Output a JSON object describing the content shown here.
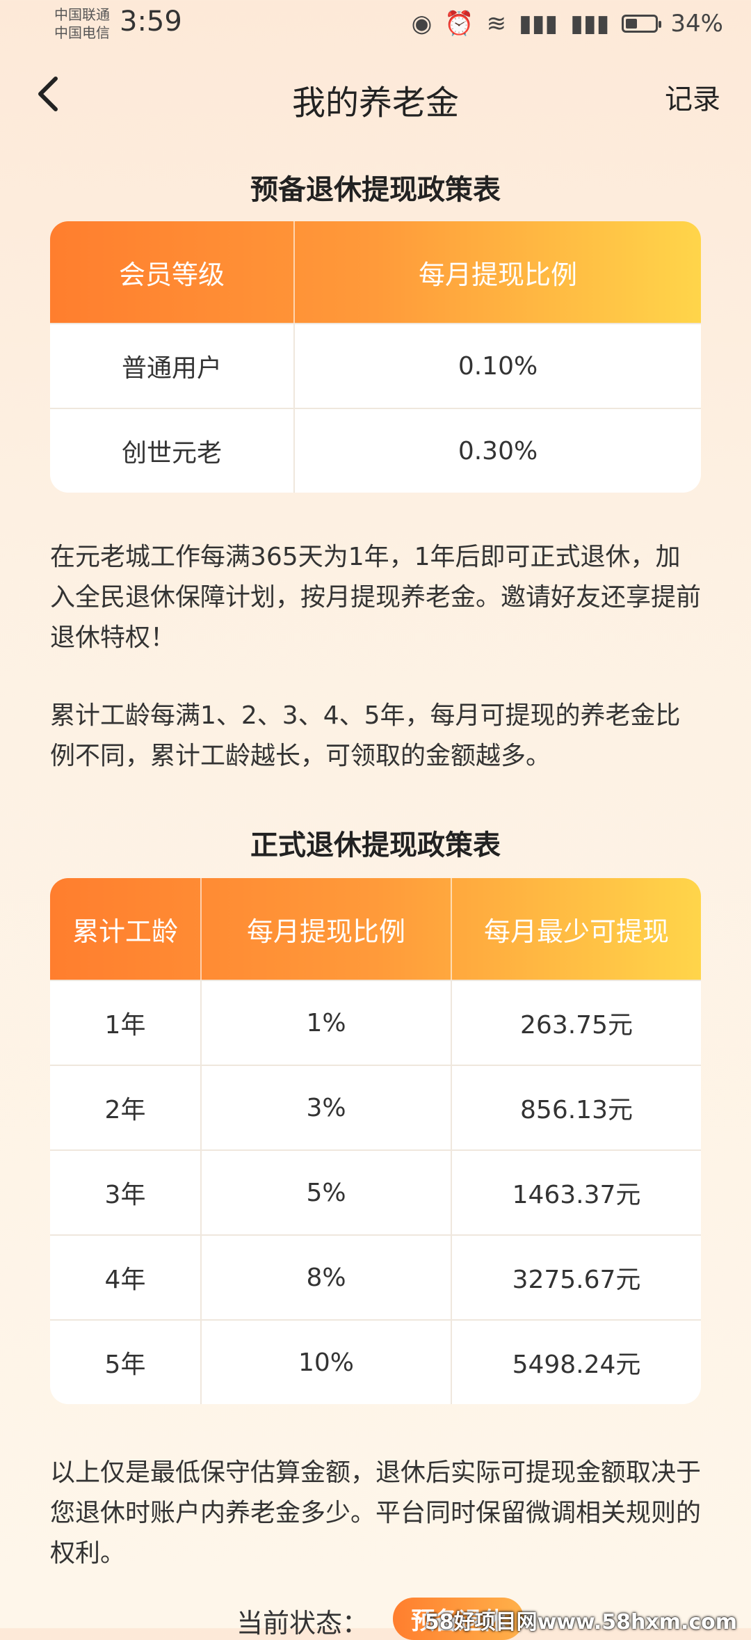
{
  "status_bar": {
    "carrier1": "中国联通",
    "carrier2": "中国电信",
    "time": "3:59",
    "battery": "34%"
  },
  "nav": {
    "back_icon": "chevron-left-icon",
    "title": "我的养老金",
    "record": "记录"
  },
  "prep_table": {
    "title": "预备退休提现政策表",
    "headers": [
      "会员等级",
      "每月提现比例"
    ],
    "rows": [
      [
        "普通用户",
        "0.10%"
      ],
      [
        "创世元老",
        "0.30%"
      ]
    ]
  },
  "paragraphs": {
    "p1": "在元老城工作每满365天为1年，1年后即可正式退休，加入全民退休保障计划，按月提现养老金。邀请好友还享提前退休特权！",
    "p2": "累计工龄每满1、2、3、4、5年，每月可提现的养老金比例不同，累计工龄越长，可领取的金额越多。",
    "p3": "以上仅是最低保守估算金额，退休后实际可提现金额取决于您退休时账户内养老金多少。平台同时保留微调相关规则的权利。"
  },
  "formal_table": {
    "title": "正式退休提现政策表",
    "headers": [
      "累计工龄",
      "每月提现比例",
      "每月最少可提现"
    ],
    "rows": [
      [
        "1年",
        "1%",
        "263.75元"
      ],
      [
        "2年",
        "3%",
        "856.13元"
      ],
      [
        "3年",
        "5%",
        "1463.37元"
      ],
      [
        "4年",
        "8%",
        "3275.67元"
      ],
      [
        "5年",
        "10%",
        "5498.24元"
      ]
    ]
  },
  "state": {
    "label": "当前状态：",
    "badge": "预备退休"
  },
  "watermark": "58好项目网www.58hxm.com"
}
